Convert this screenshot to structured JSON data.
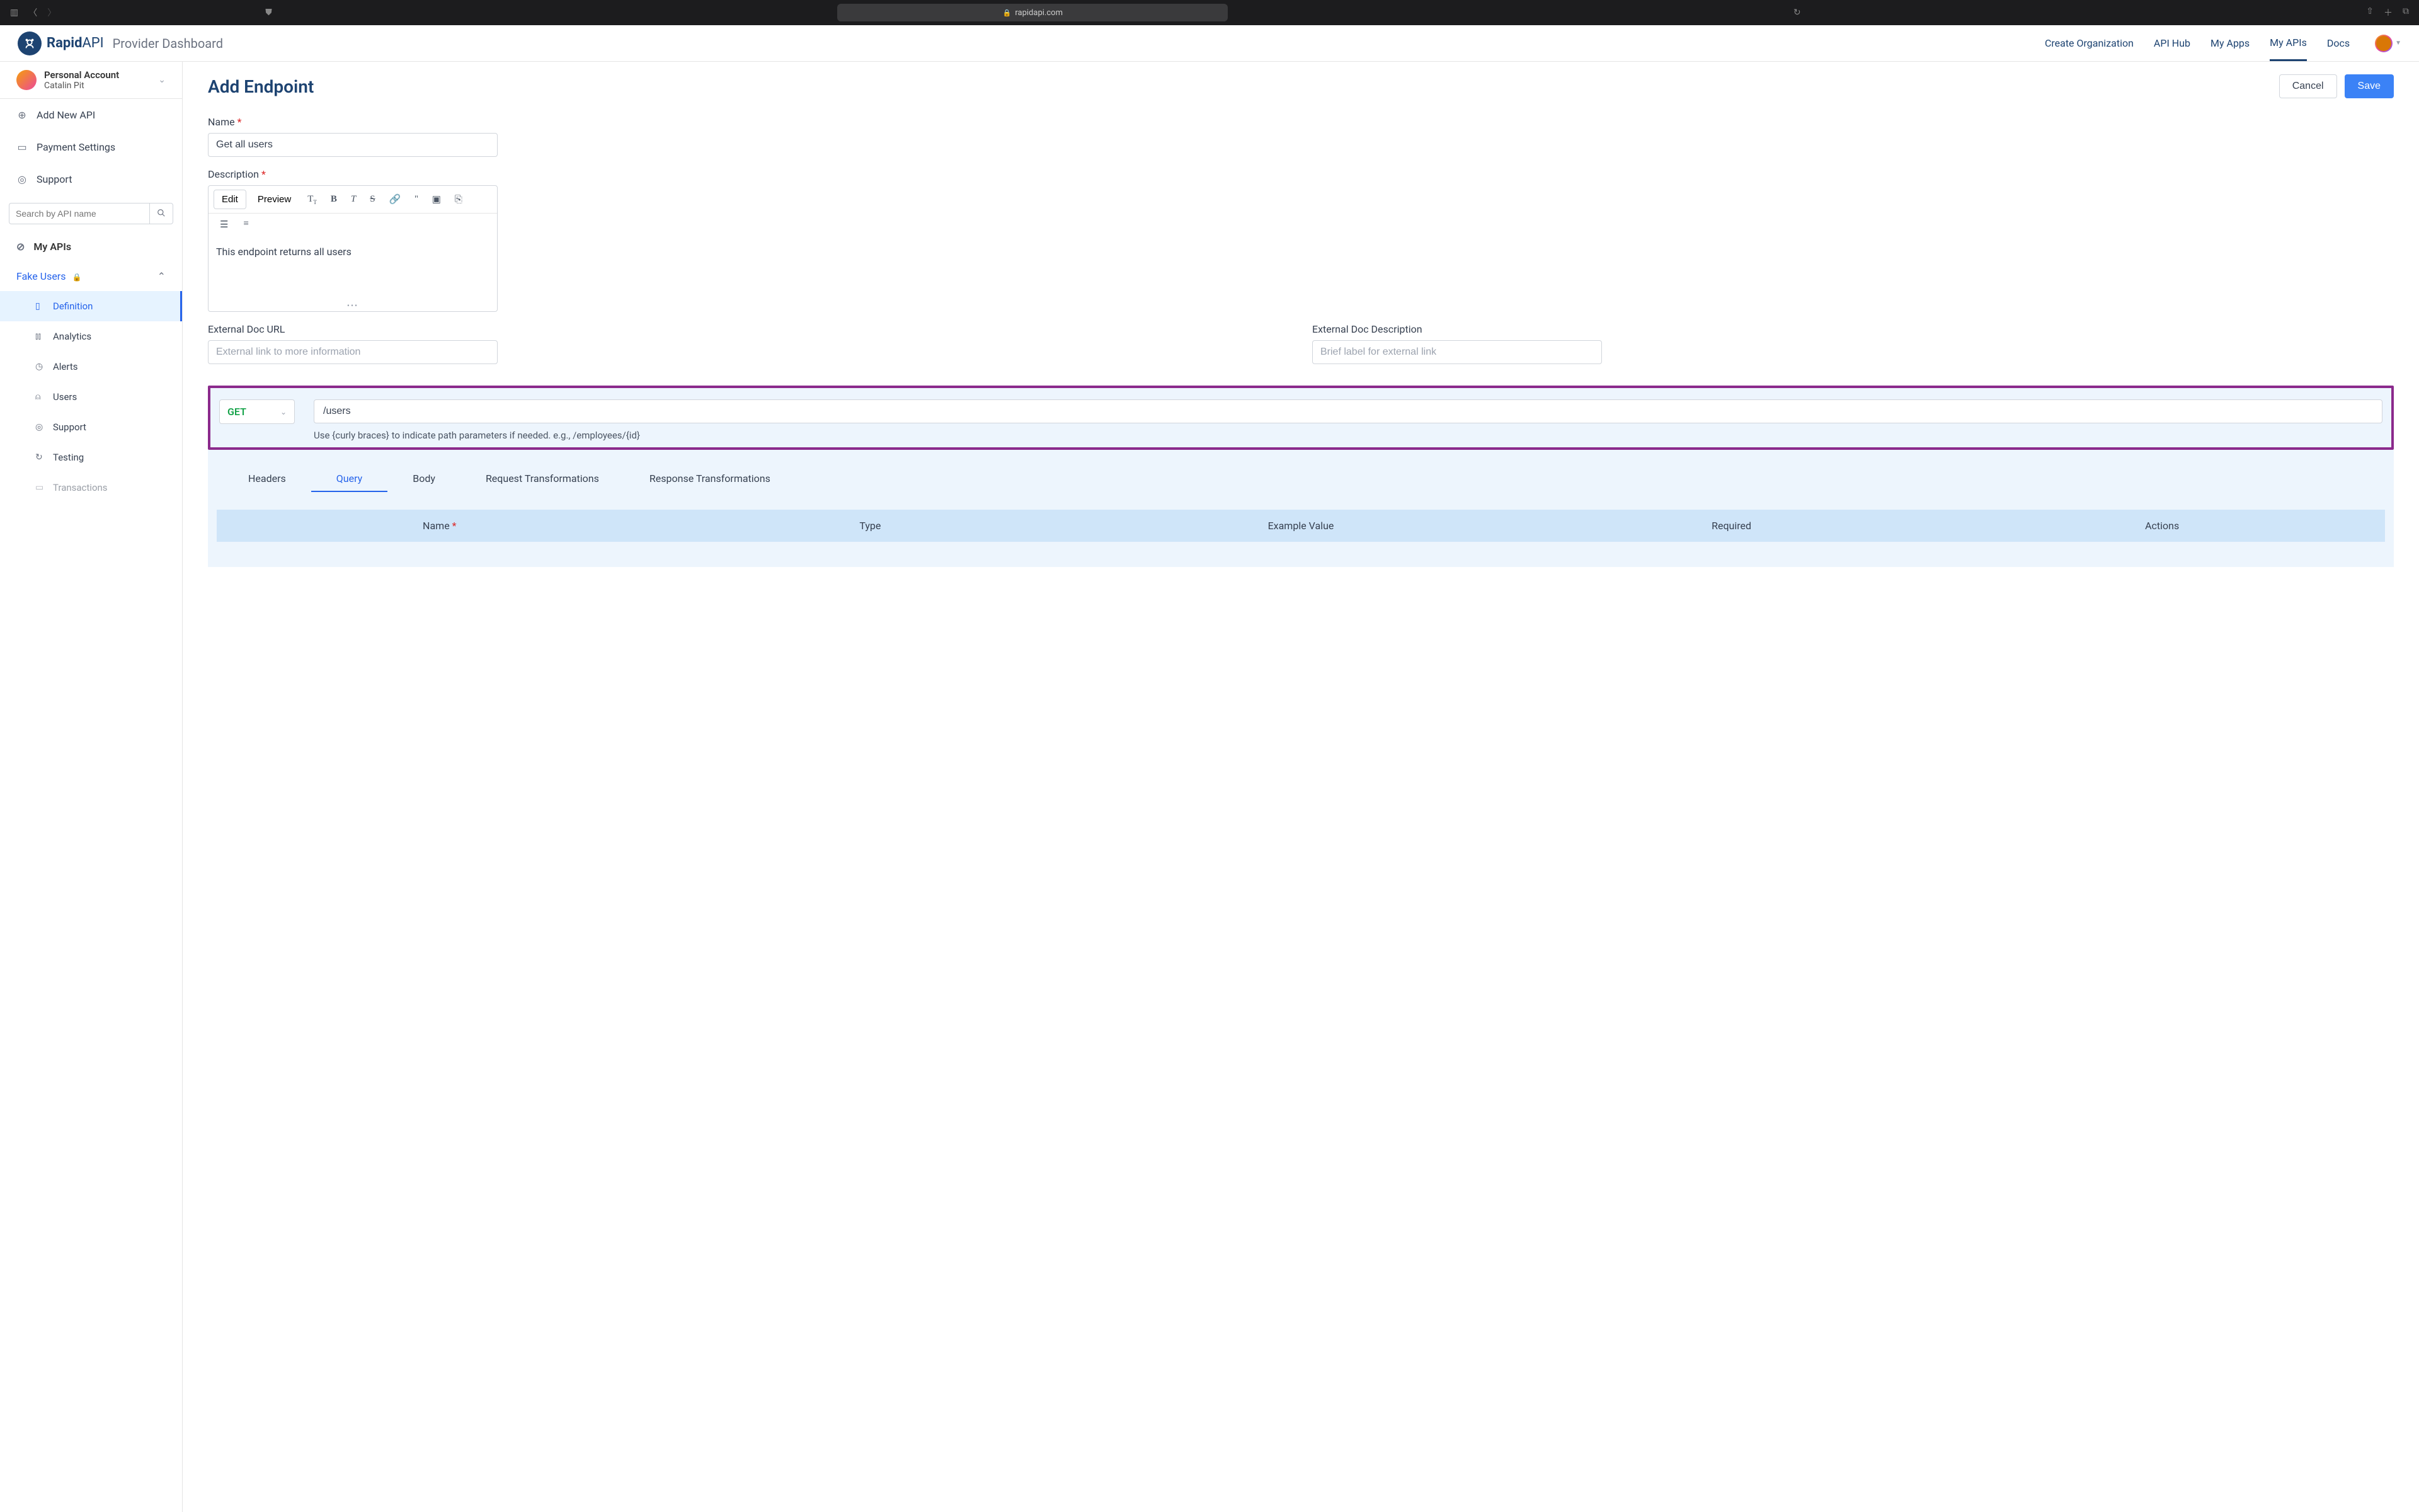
{
  "browser": {
    "url": "rapidapi.com"
  },
  "header": {
    "brand_bold": "Rapid",
    "brand_light": "API",
    "subtitle": "Provider Dashboard",
    "nav": {
      "create_org": "Create Organization",
      "api_hub": "API Hub",
      "my_apps": "My Apps",
      "my_apis": "My APIs",
      "docs": "Docs"
    }
  },
  "sidebar": {
    "account_title": "Personal Account",
    "account_name": "Catalin Pit",
    "items": {
      "add_api": "Add New API",
      "payment": "Payment Settings",
      "support": "Support",
      "search_placeholder": "Search by API name",
      "my_apis": "My APIs",
      "api_name": "Fake Users",
      "sub": {
        "definition": "Definition",
        "analytics": "Analytics",
        "alerts": "Alerts",
        "users": "Users",
        "support2": "Support",
        "testing": "Testing",
        "transactions": "Transactions"
      }
    }
  },
  "page": {
    "title": "Add Endpoint",
    "cancel": "Cancel",
    "save": "Save",
    "name_label": "Name",
    "name_value": "Get all users",
    "desc_label": "Description",
    "editor": {
      "edit": "Edit",
      "preview": "Preview",
      "body": "This endpoint returns all users"
    },
    "ext_url_label": "External Doc URL",
    "ext_url_placeholder": "External link to more information",
    "ext_desc_label": "External Doc Description",
    "ext_desc_placeholder": "Brief label for external link",
    "method": "GET",
    "path": "/users",
    "path_hint": "Use {curly braces} to indicate path parameters if needed. e.g., /employees/{id}",
    "tabs": {
      "headers": "Headers",
      "query": "Query",
      "body": "Body",
      "req_trans": "Request Transformations",
      "res_trans": "Response Transformations"
    },
    "table": {
      "name": "Name",
      "type": "Type",
      "example": "Example Value",
      "required": "Required",
      "actions": "Actions"
    }
  }
}
